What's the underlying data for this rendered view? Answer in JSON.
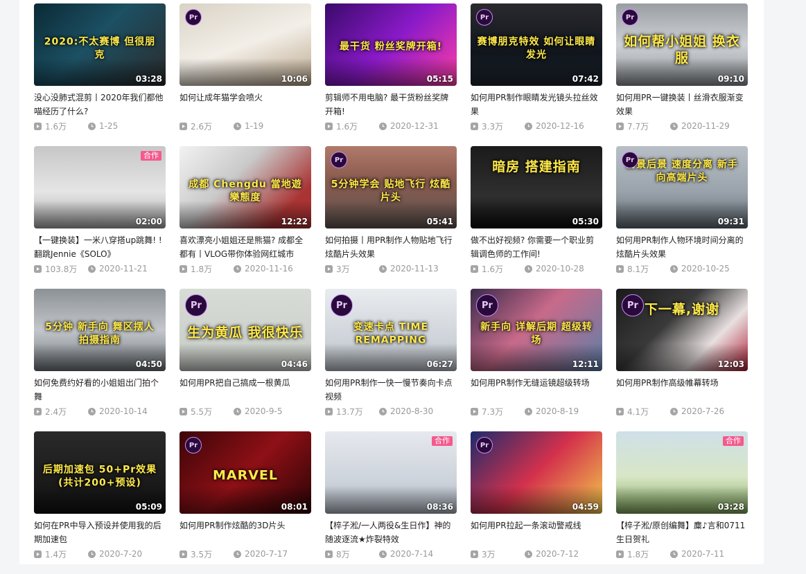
{
  "videos": [
    {
      "title": "没心没肺式混剪丨2020年我们都他喵经历了什么?",
      "plays": "1.6万",
      "date": "1-25",
      "duration": "03:28",
      "caption": "2020:不太赛博 但很朋克",
      "badge": "",
      "pr": false
    },
    {
      "title": "如何让成年猫学会喷火",
      "plays": "2.6万",
      "date": "1-19",
      "duration": "10:06",
      "caption": "",
      "badge": "",
      "pr": true
    },
    {
      "title": "剪辑师不用电脑? 最干货粉丝奖牌开箱!",
      "plays": "1.6万",
      "date": "2020-12-31",
      "duration": "05:15",
      "caption": "最干货 粉丝奖牌开箱!",
      "badge": "",
      "pr": false
    },
    {
      "title": "如何用PR制作眼睛发光镜头拉丝效果",
      "plays": "3.3万",
      "date": "2020-12-16",
      "duration": "07:42",
      "caption": "赛博朋克特效 如何让眼睛发光",
      "badge": "",
      "pr": true
    },
    {
      "title": "如何用PR一键换装丨丝滑衣服渐变效果",
      "plays": "7.7万",
      "date": "2020-11-29",
      "duration": "09:10",
      "caption": "如何帮小姐姐 换衣服",
      "badge": "",
      "pr": true
    },
    {
      "title": "【一键换装】一米八穿搭up跳舞! ! 翻跳Jennie《SOLO》",
      "plays": "103.8万",
      "date": "2020-11-21",
      "duration": "02:00",
      "caption": "",
      "badge": "合作",
      "pr": false
    },
    {
      "title": "喜欢漂亮小姐姐还是熊猫? 成都全都有丨VLOG带你体验网红城市",
      "plays": "1.8万",
      "date": "2020-11-16",
      "duration": "12:22",
      "caption": "成都 Chengdu 當地遊樂態度",
      "badge": "",
      "pr": false
    },
    {
      "title": "如何拍摄丨用PR制作人物贴地飞行炫酷片头效果",
      "plays": "3万",
      "date": "2020-11-13",
      "duration": "05:41",
      "caption": "5分钟学会 贴地飞行 炫酷片头",
      "badge": "",
      "pr": true
    },
    {
      "title": "做不出好视频? 你需要一个职业剪辑调色师的工作间!",
      "plays": "1.6万",
      "date": "2020-10-28",
      "duration": "05:30",
      "caption": "暗房 搭建指南",
      "badge": "",
      "pr": false
    },
    {
      "title": "如何用PR制作人物环境时间分离的炫酷片头效果",
      "plays": "8.1万",
      "date": "2020-10-25",
      "duration": "09:31",
      "caption": "前景后景 速度分离 新手向高端片头",
      "badge": "",
      "pr": true
    },
    {
      "title": "如何免费约好看的小姐姐出门拍个舞",
      "plays": "2.4万",
      "date": "2020-10-14",
      "duration": "04:50",
      "caption": "5分钟 新手向 舞区摆人 拍摄指南",
      "badge": "",
      "pr": false
    },
    {
      "title": "如何用PR把自己搞成一根黄瓜",
      "plays": "5.5万",
      "date": "2020-9-5",
      "duration": "04:46",
      "caption": "生为黄瓜 我很快乐",
      "badge": "",
      "pr": true
    },
    {
      "title": "如何用PR制作一快一慢节奏向卡点视频",
      "plays": "13.7万",
      "date": "2020-8-30",
      "duration": "06:27",
      "caption": "变速卡点 TIME REMAPPING",
      "badge": "",
      "pr": true
    },
    {
      "title": "如何用PR制作无缝运镜超级转场",
      "plays": "7.3万",
      "date": "2020-8-19",
      "duration": "12:11",
      "caption": "新手向 详解后期 超级转场",
      "badge": "",
      "pr": true
    },
    {
      "title": "如何用PR制作高级帷幕转场",
      "plays": "4.1万",
      "date": "2020-7-26",
      "duration": "12:03",
      "caption": "下一幕,谢谢",
      "badge": "",
      "pr": true
    },
    {
      "title": "如何在PR中导入预设并使用我的后期加速包",
      "plays": "1.4万",
      "date": "2020-7-20",
      "duration": "05:09",
      "caption": "后期加速包 50+Pr效果 (共计200+预设)",
      "badge": "",
      "pr": false
    },
    {
      "title": "如何用PR制作炫酷的3D片头",
      "plays": "3.5万",
      "date": "2020-7-17",
      "duration": "08:01",
      "caption": "MARVEL",
      "badge": "",
      "pr": true
    },
    {
      "title": "【椊子淞/一人两役&生日作】神的随波逐流★炸裂特效",
      "plays": "8万",
      "date": "2020-7-14",
      "duration": "08:36",
      "caption": "",
      "badge": "合作",
      "pr": false
    },
    {
      "title": "如何用PR拉起一条滚动警戒线",
      "plays": "3万",
      "date": "2020-7-12",
      "duration": "04:59",
      "caption": "",
      "badge": "",
      "pr": true
    },
    {
      "title": "【椊子淞/原创编舞】麋♪言和0711生日贺礼",
      "plays": "1.8万",
      "date": "2020-7-11",
      "duration": "03:28",
      "caption": "",
      "badge": "合作",
      "pr": false
    }
  ],
  "icons": {
    "play": "play-count-icon",
    "date": "clock-icon"
  },
  "colors": {
    "accent": "#f45a8d",
    "meta": "#999999",
    "title": "#212121"
  }
}
